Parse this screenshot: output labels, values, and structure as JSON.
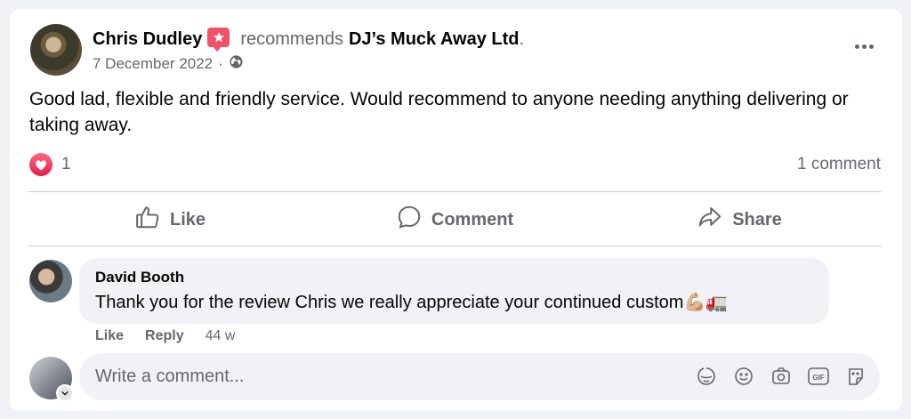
{
  "post": {
    "author": "Chris Dudley",
    "verb": "recommends",
    "page": "DJ’s Muck Away Ltd",
    "date": "7 December 2022",
    "separator": "·",
    "text": "Good lad, flexible and friendly service. Would recommend to anyone needing anything delivering or taking away.",
    "reaction_count": "1",
    "comment_count": "1 comment"
  },
  "actions": {
    "like": "Like",
    "comment": "Comment",
    "share": "Share"
  },
  "comment": {
    "author": "David Booth",
    "text": "Thank you for the review Chris we really appreciate your continued custom",
    "emojis": "💪🏼🚛",
    "like": "Like",
    "reply": "Reply",
    "age": "44 w"
  },
  "composer": {
    "placeholder": "Write a comment..."
  },
  "colors": {
    "recommend_badge": "#f25268",
    "love_reaction": "#e61e4d",
    "secondary_text": "#65676b"
  },
  "icons": [
    "recommend-star-icon",
    "globe-icon",
    "more-icon",
    "love-reaction-icon",
    "like-icon",
    "comment-icon",
    "share-icon",
    "chevron-down-icon",
    "sticker-icon",
    "emoji-icon",
    "camera-icon",
    "gif-icon",
    "avatar-sticker-icon"
  ]
}
